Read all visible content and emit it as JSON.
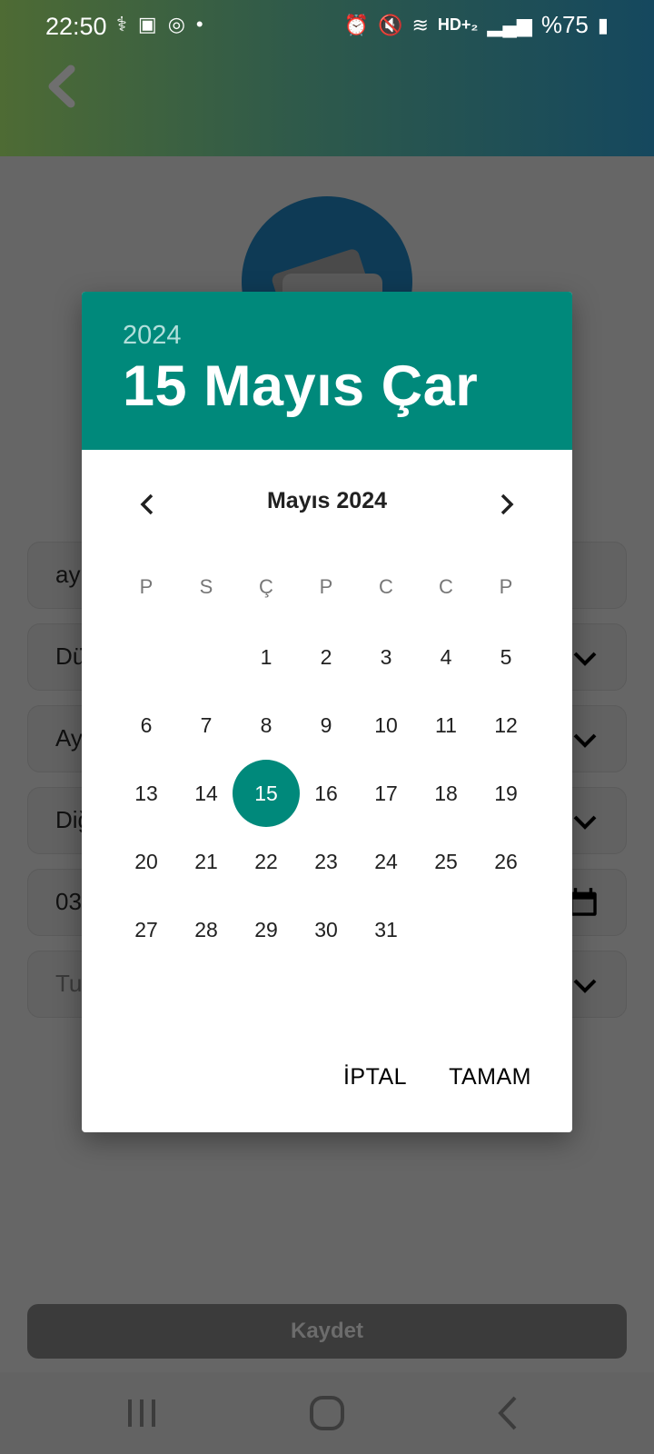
{
  "status_bar": {
    "time": "22:50",
    "battery": "%75",
    "network": "HD+₂"
  },
  "background_form": {
    "fields": [
      {
        "text": "ay"
      },
      {
        "text": "Dü"
      },
      {
        "text": "Ay"
      },
      {
        "text": "Diğ"
      },
      {
        "text": "03"
      },
      {
        "text": "Tu"
      }
    ],
    "save_button": "Kaydet"
  },
  "date_picker": {
    "year": "2024",
    "selected_date_label": "15 Mayıs Çar",
    "month_title": "Mayıs 2024",
    "weekdays": [
      "P",
      "S",
      "Ç",
      "P",
      "C",
      "C",
      "P"
    ],
    "weeks": [
      [
        "",
        "",
        "1",
        "2",
        "3",
        "4",
        "5"
      ],
      [
        "6",
        "7",
        "8",
        "9",
        "10",
        "11",
        "12"
      ],
      [
        "13",
        "14",
        "15",
        "16",
        "17",
        "18",
        "19"
      ],
      [
        "20",
        "21",
        "22",
        "23",
        "24",
        "25",
        "26"
      ],
      [
        "27",
        "28",
        "29",
        "30",
        "31",
        "",
        ""
      ]
    ],
    "selected_day": "15",
    "cancel_label": "İPTAL",
    "ok_label": "TAMAM",
    "accent_color": "#00897b"
  }
}
